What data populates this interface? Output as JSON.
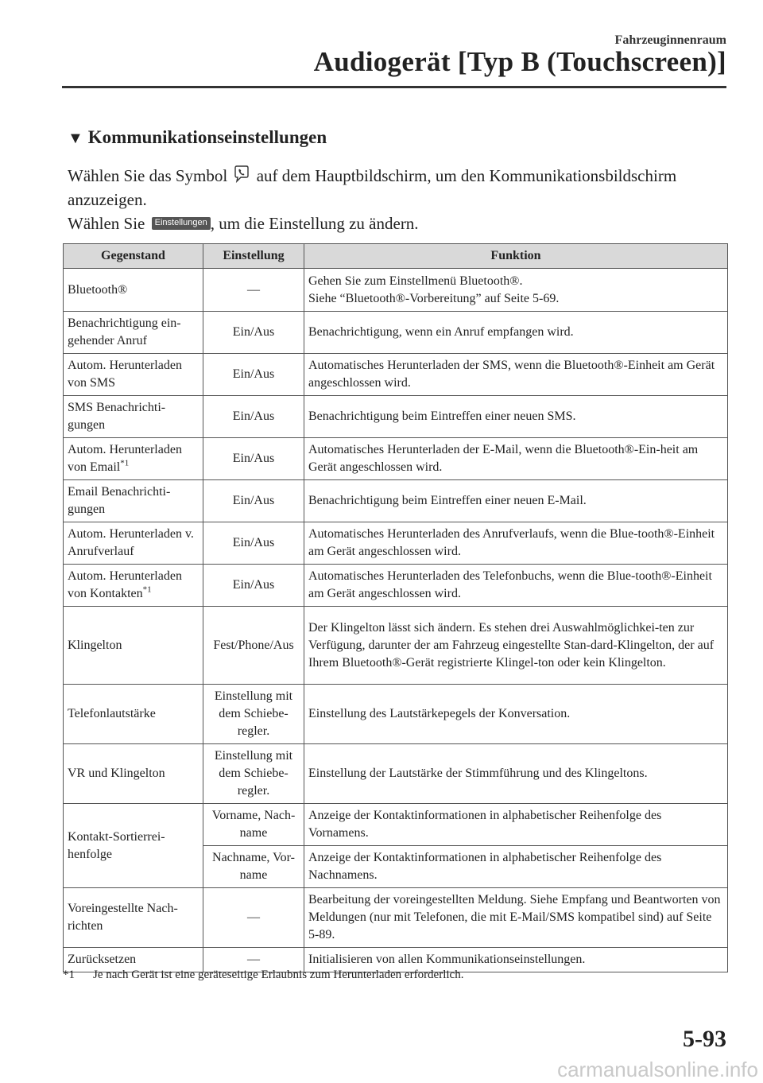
{
  "header": {
    "section": "Fahrzeuginnenraum",
    "title": "Audiogerät [Typ B (Touchscreen)]"
  },
  "section_title": "Kommunikationseinstellungen",
  "intro": {
    "line1_before": "Wählen Sie das Symbol",
    "line1_after": "auf dem Hauptbildschirm, um den Kommunikationsbildschirm anzuzeigen.",
    "line2_before": "Wählen Sie",
    "button_label": "Einstellungen",
    "line2_after": ", um die Einstellung zu ändern."
  },
  "table": {
    "headers": [
      "Gegenstand",
      "Einstellung",
      "Funktion"
    ],
    "rows": [
      {
        "item": "Bluetooth®",
        "setting": "—",
        "function_a": "Gehen Sie zum Einstellmenü Bluetooth®.",
        "function_b": "Siehe “Bluetooth®-Vorbereitung” auf Seite 5-69."
      },
      {
        "item": "Benachrichtigung ein-gehender Anruf",
        "setting": "Ein/Aus",
        "function": "Benachrichtigung, wenn ein Anruf empfangen wird."
      },
      {
        "item": "Autom. Herunterladen von SMS",
        "setting": "Ein/Aus",
        "function": "Automatisches Herunterladen der SMS, wenn die Bluetooth®-Einheit am Gerät angeschlossen wird."
      },
      {
        "item": "SMS Benachrichti-gungen",
        "setting": "Ein/Aus",
        "function": "Benachrichtigung beim Eintreffen einer neuen SMS."
      },
      {
        "item": "Autom. Herunterladen von Email",
        "footnote_ref": "*1",
        "setting": "Ein/Aus",
        "function": "Automatisches Herunterladen der E-Mail, wenn die Bluetooth®-Ein-heit am Gerät angeschlossen wird."
      },
      {
        "item": "Email Benachrichti-gungen",
        "setting": "Ein/Aus",
        "function": "Benachrichtigung beim Eintreffen einer neuen E-Mail."
      },
      {
        "item": "Autom. Herunterladen v. Anrufverlauf",
        "setting": "Ein/Aus",
        "function": "Automatisches Herunterladen des Anrufverlaufs, wenn die Blue-tooth®-Einheit am Gerät angeschlossen wird."
      },
      {
        "item": "Autom. Herunterladen von Kontakten",
        "footnote_ref": "*1",
        "setting": "Ein/Aus",
        "function": "Automatisches Herunterladen des Telefonbuchs, wenn die Blue-tooth®-Einheit am Gerät angeschlossen wird."
      },
      {
        "item": "Klingelton",
        "setting": "Fest/Phone/Aus",
        "function": "Der Klingelton lässt sich ändern. Es stehen drei Auswahlmöglichkei-ten zur Verfügung, darunter der am Fahrzeug eingestellte Stan-dard-Klingelton, der auf Ihrem Bluetooth®-Gerät registrierte Klingel-ton oder kein Klingelton."
      },
      {
        "item": "Telefonlautstärke",
        "setting": "Einstellung mit dem Schiebe-regler.",
        "function": "Einstellung des Lautstärkepegels der Konversation."
      },
      {
        "item": "VR und Klingelton",
        "setting": "Einstellung mit dem Schiebe-regler.",
        "function": "Einstellung der Lautstärke der Stimmführung und des Klingeltons."
      },
      {
        "item": "Kontakt-Sortierrei-henfolge",
        "setting": "Vorname, Nach-name",
        "function": "Anzeige der Kontaktinformationen in alphabetischer Reihenfolge des Vornamens."
      },
      {
        "setting": "Nachname, Vor-name",
        "function": "Anzeige der Kontaktinformationen in alphabetischer Reihenfolge des Nachnamens."
      },
      {
        "item": "Voreingestellte Nach-richten",
        "setting": "—",
        "function": "Bearbeitung der voreingestellten Meldung. Siehe Empfang und Beantworten von Meldungen (nur mit Telefonen, die mit E-Mail/SMS kompatibel sind) auf Seite 5-89."
      },
      {
        "item": "Zurücksetzen",
        "setting": "—",
        "function": "Initialisieren von allen Kommunikationseinstellungen."
      }
    ]
  },
  "footnote": {
    "mark": "*1",
    "text": "Je nach Gerät ist eine geräteseitige Erlaubnis zum Herunterladen erforderlich."
  },
  "page_number": "5-93",
  "watermark": "carmanualsonline.info"
}
